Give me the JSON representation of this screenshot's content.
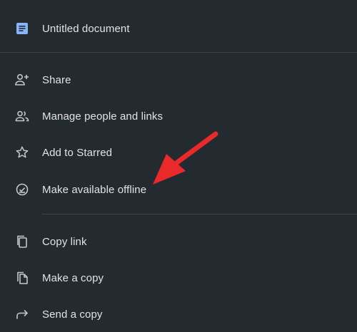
{
  "header": {
    "title": "Untitled document",
    "icon": "docs-document-icon"
  },
  "menu": {
    "items": [
      {
        "label": "Share",
        "icon": "person-add-icon"
      },
      {
        "label": "Manage people and links",
        "icon": "people-icon"
      },
      {
        "label": "Add to Starred",
        "icon": "star-icon"
      },
      {
        "label": "Make available offline",
        "icon": "offline-check-icon"
      },
      {
        "label": "Copy link",
        "icon": "copy-icon"
      },
      {
        "label": "Make a copy",
        "icon": "file-copy-icon"
      },
      {
        "label": "Send a copy",
        "icon": "forward-arrow-icon"
      }
    ]
  },
  "colors": {
    "background": "#232a30",
    "text": "#e3e3e3",
    "icon": "#c4c7c5",
    "docs_blue": "#8ab4f8",
    "annotation_arrow": "#ea2a2a"
  }
}
